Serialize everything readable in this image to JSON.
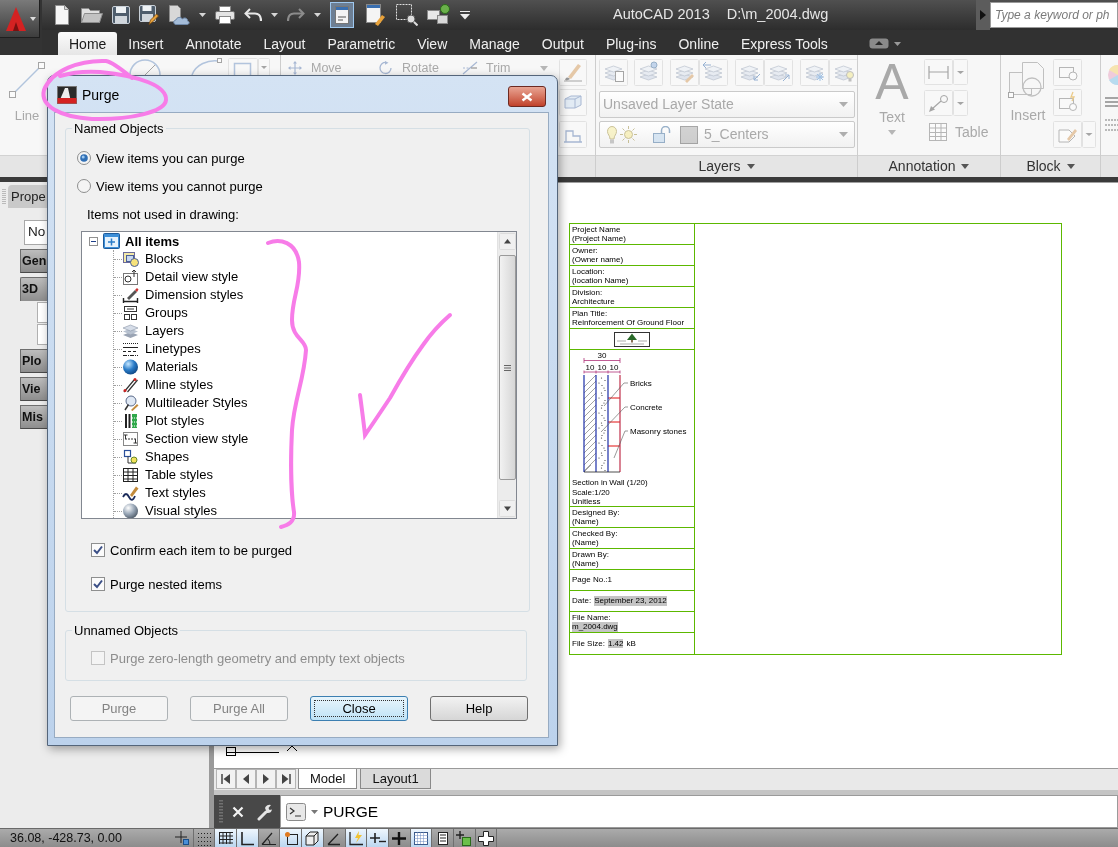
{
  "title_bar": {
    "app_name": "AutoCAD 2013",
    "file_name": "D:\\m_2004.dwg",
    "search": {
      "placeholder": "Type a keyword or ph"
    }
  },
  "ribbon": {
    "disabled": true,
    "tabs": [
      {
        "label": "Home",
        "selected": true
      },
      {
        "label": "Insert",
        "selected": false
      },
      {
        "label": "Annotate",
        "selected": false
      },
      {
        "label": "Layout",
        "selected": false
      },
      {
        "label": "Parametric",
        "selected": false
      },
      {
        "label": "View",
        "selected": false
      },
      {
        "label": "Manage",
        "selected": false
      },
      {
        "label": "Output",
        "selected": false
      },
      {
        "label": "Plug-ins",
        "selected": false
      },
      {
        "label": "Online",
        "selected": false
      },
      {
        "label": "Express Tools",
        "selected": false
      }
    ],
    "draw_panel": {
      "line_tool": "Line"
    },
    "modify_panel": {
      "tools": [
        "Move",
        "Rotate",
        "Trim"
      ]
    },
    "layers_panel": {
      "layer_state": "Unsaved Layer State",
      "current_layer": "5_Centers",
      "title": "Layers"
    },
    "annotation_panel": {
      "text_tool": {
        "glyph": "A",
        "label": "Text"
      },
      "table_tool": "Table",
      "title": "Annotation"
    },
    "block_panel": {
      "insert_tool": "Insert",
      "title": "Block"
    }
  },
  "properties_palette": {
    "title": "Prope",
    "selection": "No",
    "categories": [
      {
        "label": "Gen",
        "expanded": false
      },
      {
        "label": "3D",
        "expanded": true
      },
      {
        "label": "Plo",
        "expanded": false
      },
      {
        "label": "Vie",
        "expanded": false
      },
      {
        "label": "Mis",
        "expanded": false
      }
    ]
  },
  "drawing": {
    "title_block": {
      "rows": [
        {
          "kind": "text",
          "lines": [
            [
              {
                "text": "Project Name",
                "field": false
              }
            ],
            [
              {
                "text": "(Project Name)",
                "field": false
              }
            ]
          ]
        },
        {
          "kind": "text",
          "lines": [
            [
              {
                "text": "Owner:",
                "field": false
              }
            ],
            [
              {
                "text": "(Owner name)",
                "field": false
              }
            ]
          ]
        },
        {
          "kind": "text",
          "lines": [
            [
              {
                "text": "Location:",
                "field": false
              }
            ],
            [
              {
                "text": "(location Name)",
                "field": false
              }
            ]
          ]
        },
        {
          "kind": "text",
          "lines": [
            [
              {
                "text": "Division:",
                "field": false
              }
            ],
            [
              {
                "text": "Architecture",
                "field": false
              }
            ]
          ]
        },
        {
          "kind": "text",
          "lines": [
            [
              {
                "text": "Plan Title:",
                "field": false
              }
            ],
            [
              {
                "text": "Reinforcement Of Ground Floor",
                "field": false
              }
            ]
          ]
        },
        {
          "kind": "logo"
        },
        {
          "kind": "section",
          "dimensions": {
            "overall": "30",
            "parts": [
              "10",
              "10",
              "10"
            ]
          },
          "materials": [
            "Bricks",
            "Concrete",
            "Masonry stones"
          ],
          "caption": "Section in Wall (1/20)",
          "notes": [
            "Scale:1/20",
            "Unitless"
          ]
        },
        {
          "kind": "text",
          "lines": [
            [
              {
                "text": "Designed By:",
                "field": false
              }
            ],
            [
              {
                "text": "(Name)",
                "field": false
              }
            ]
          ]
        },
        {
          "kind": "text",
          "lines": [
            [
              {
                "text": "Checked By:",
                "field": false
              }
            ],
            [
              {
                "text": "(Name)",
                "field": false
              }
            ]
          ]
        },
        {
          "kind": "text",
          "lines": [
            [
              {
                "text": "Drawn By:",
                "field": false
              }
            ],
            [
              {
                "text": "(Name)",
                "field": false
              }
            ]
          ]
        },
        {
          "kind": "text",
          "lines": [
            [
              {
                "text": "Page No.:1",
                "field": false
              }
            ]
          ]
        },
        {
          "kind": "text",
          "lines": [
            [
              {
                "text": "Date:",
                "field": false
              },
              {
                "text": "September 23, 2012",
                "field": true
              }
            ]
          ]
        },
        {
          "kind": "text",
          "lines": [
            [
              {
                "text": "File Name:",
                "field": false
              }
            ],
            [
              {
                "text": "m_2004.dwg",
                "field": true
              }
            ]
          ]
        },
        {
          "kind": "text",
          "lines": [
            [
              {
                "text": "File Size:",
                "field": false
              },
              {
                "text": "1.42",
                "field": true
              },
              {
                "text": "kB",
                "field": false
              }
            ]
          ]
        }
      ]
    }
  },
  "layout_tabs": [
    {
      "label": "Model",
      "selected": true
    },
    {
      "label": "Layout1",
      "selected": false
    }
  ],
  "command_line": {
    "value": "PURGE"
  },
  "status_bar": {
    "coordinates": "36.08, -428.73, 0.00",
    "toggles": [
      {
        "on": false
      },
      {
        "on": false
      },
      {
        "on": true
      },
      {
        "on": true
      },
      {
        "on": false
      },
      {
        "on": true
      },
      {
        "on": true
      },
      {
        "on": false
      },
      {
        "on": true
      },
      {
        "on": true
      },
      {
        "on": false
      },
      {
        "on": true
      },
      {
        "on": false
      },
      {
        "on": false
      },
      {
        "on": false
      }
    ]
  },
  "purge_dialog": {
    "title": "Purge",
    "named_objects": {
      "label": "Named Objects",
      "view_options": [
        {
          "label": "View items you can purge",
          "selected": true
        },
        {
          "label": "View items you cannot purge",
          "selected": false
        }
      ],
      "tree_label": "Items not used in drawing:",
      "tree": {
        "label": "All items",
        "expanded": true,
        "selected": false,
        "children": [
          {
            "label": "Blocks",
            "selected": false
          },
          {
            "label": "Detail view style",
            "selected": false
          },
          {
            "label": "Dimension styles",
            "selected": false
          },
          {
            "label": "Groups",
            "selected": false
          },
          {
            "label": "Layers",
            "selected": false
          },
          {
            "label": "Linetypes",
            "selected": false
          },
          {
            "label": "Materials",
            "selected": false
          },
          {
            "label": "Mline styles",
            "selected": false
          },
          {
            "label": "Multileader Styles",
            "selected": false
          },
          {
            "label": "Plot styles",
            "selected": false
          },
          {
            "label": "Section view style",
            "selected": false
          },
          {
            "label": "Shapes",
            "selected": false
          },
          {
            "label": "Table styles",
            "selected": false
          },
          {
            "label": "Text styles",
            "selected": false
          },
          {
            "label": "Visual styles",
            "selected": false
          }
        ]
      },
      "options": [
        {
          "label": "Confirm each item to be purged",
          "checked": true,
          "disabled": false
        },
        {
          "label": "Purge nested items",
          "checked": true,
          "disabled": false
        }
      ]
    },
    "unnamed_objects": {
      "label": "Unnamed Objects",
      "options": [
        {
          "label": "Purge zero-length geometry and empty text objects",
          "checked": false,
          "disabled": true
        }
      ]
    },
    "buttons": [
      {
        "label": "Purge",
        "disabled": true,
        "focused": false
      },
      {
        "label": "Purge All",
        "disabled": true,
        "focused": false
      },
      {
        "label": "Close",
        "disabled": false,
        "focused": true
      },
      {
        "label": "Help",
        "disabled": false,
        "focused": false
      }
    ]
  }
}
